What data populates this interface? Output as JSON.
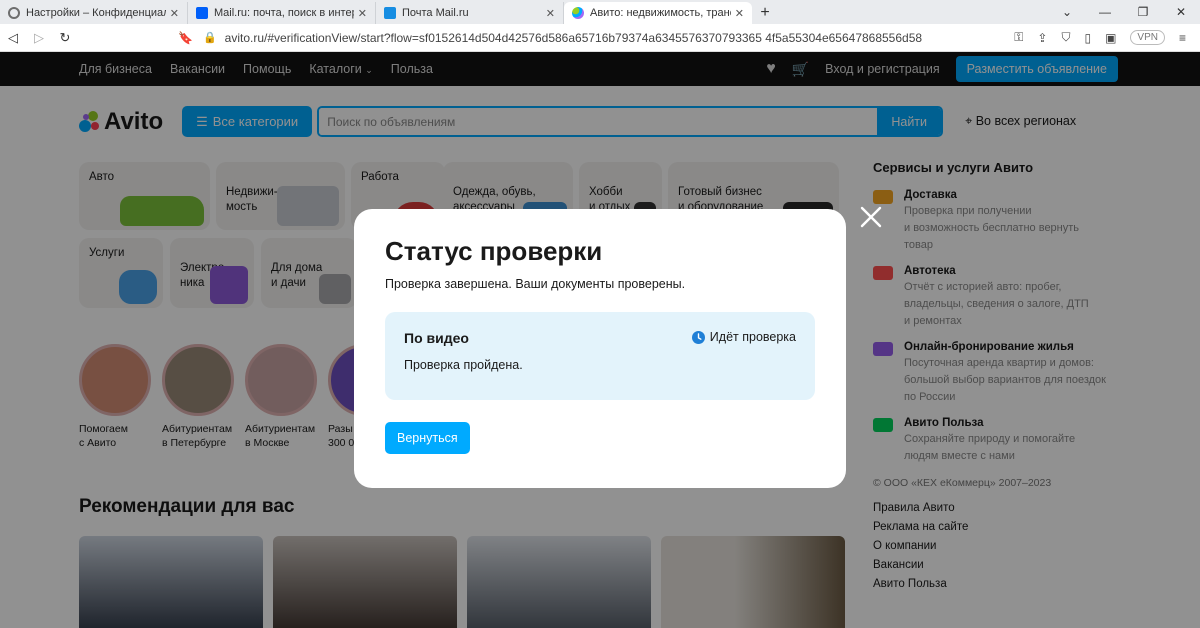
{
  "browser": {
    "tabs": [
      {
        "title": "Настройки – Конфиденциальность и",
        "favicon_color": "#6e6e6e",
        "active": false
      },
      {
        "title": "Mail.ru: почта, поиск в интернете, но",
        "favicon_color": "#005ff9",
        "active": false
      },
      {
        "title": "Почта Mail.ru",
        "favicon_color": "#168de2",
        "active": false
      },
      {
        "title": "Авито: недвижимость, транспор",
        "favicon_color": "#97cf26",
        "active": true
      }
    ],
    "url": "avito.ru/#verificationView/start?flow=sf0152614d504d42576d586a65716b79374a6345576370793365 4f5a55304e65647868556d58",
    "vpn_label": "VPN"
  },
  "topnav": {
    "links": [
      "Для бизнеса",
      "Вакансии",
      "Помощь",
      "Каталоги",
      "Польза"
    ],
    "login": "Вход и регистрация",
    "place_ad": "Разместить объявление"
  },
  "header": {
    "logo": "Avito",
    "categories_button": "Все категории",
    "search_placeholder": "Поиск по объявлениям",
    "search_button": "Найти",
    "region": "Во всех регионах"
  },
  "category_tiles": [
    {
      "label": "Авто"
    },
    {
      "label": "Недвижи-\nмость"
    },
    {
      "label": "Работа"
    },
    {
      "label": "Одежда, обувь,\nаксессуары"
    },
    {
      "label": "Хобби\nи отдых"
    },
    {
      "label": "Готовый бизнес\nи оборудование"
    },
    {
      "label": "Услуги"
    },
    {
      "label": "Электро-\nника"
    },
    {
      "label": "Для дома\nи дачи"
    }
  ],
  "stories": [
    {
      "caption": "Помогаем\nс Авито"
    },
    {
      "caption": "Абитуриентам\nв Петербурге"
    },
    {
      "caption": "Абитуриентам\nв Москве"
    },
    {
      "caption": "Разы\n300 0"
    }
  ],
  "recommendations": {
    "title": "Рекомендации для вас"
  },
  "sidebar": {
    "title": "Сервисы и услуги Авито",
    "services": [
      {
        "name": "Доставка",
        "desc": "Проверка при получении\nи возможность бесплатно вернуть\nтовар",
        "color": "#f5a623"
      },
      {
        "name": "Автотека",
        "desc": "Отчёт с историей авто: пробег,\nвладельцы, сведения о залоге, ДТП\nи ремонтах",
        "color": "#ff4f4f"
      },
      {
        "name": "Онлайн-бронирование жилья",
        "desc": "Посуточная аренда квартир и домов:\nбольшой выбор вариантов для поездок\nпо России",
        "color": "#965eeb"
      },
      {
        "name": "Авито Польза",
        "desc": "Сохраняйте природу и помогайте\nлюдям вместе с нами",
        "color": "#02d15c"
      }
    ],
    "copyright": "© ООО «КЕХ еКоммерц» 2007–2023",
    "footer_links": [
      "Правила Авито",
      "Реклама на сайте",
      "О компании",
      "Вакансии",
      "Авито Польза"
    ]
  },
  "modal": {
    "title": "Статус проверки",
    "subtitle": "Проверка завершена. Ваши документы проверены.",
    "card": {
      "label": "По видео",
      "status": "Идёт проверка",
      "text": "Проверка пройдена."
    },
    "button": "Вернуться"
  },
  "colors": {
    "accent": "#00aaff",
    "card_bg": "#e3f3fb",
    "overlay": "rgba(0,0,0,0.43)"
  }
}
